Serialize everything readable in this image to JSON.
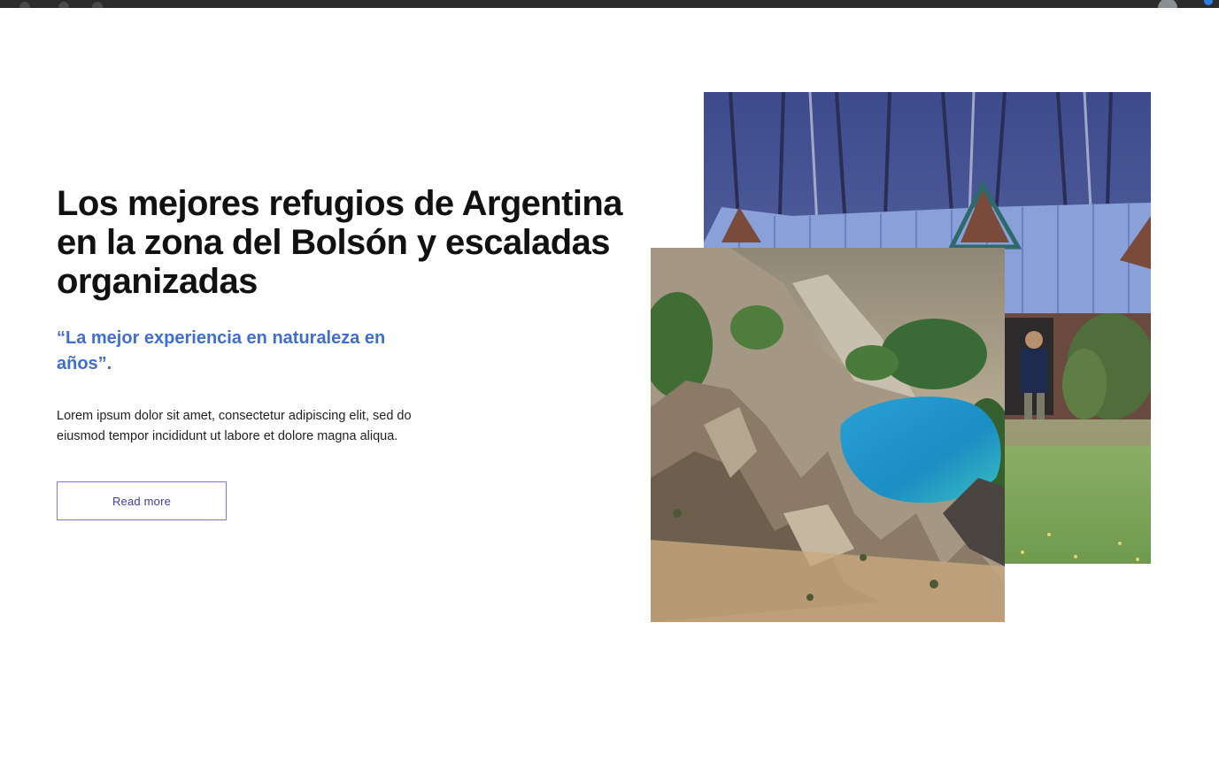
{
  "hero": {
    "headline": "Los mejores refugios de Argentina en la zona del Bolsón y escaladas organizadas",
    "quote": "“La mejor experiencia en naturaleza en años”.",
    "body": "Lorem ipsum dolor sit amet, consectetur adipiscing elit, sed do eiusmod tempor incididunt ut labore et dolore magna aliqua.",
    "button_label": "Read more"
  },
  "colors": {
    "headline": "#111111",
    "accent_blue": "#3f6fce",
    "button_border": "#8a6fd8",
    "button_text": "#3f3aa5"
  },
  "images": {
    "back": "mountain-cabin-photo",
    "front": "mountain-lake-photo"
  }
}
